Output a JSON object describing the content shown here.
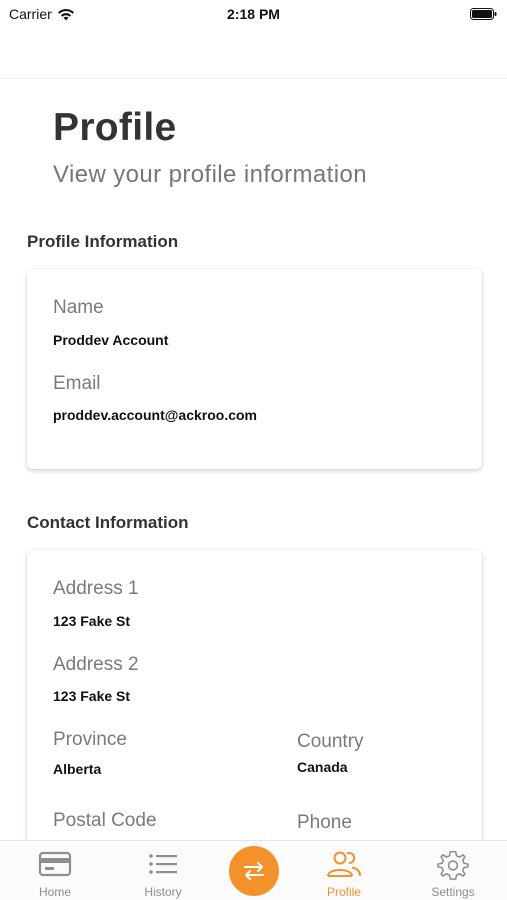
{
  "status_bar": {
    "carrier": "Carrier",
    "time": "2:18 PM"
  },
  "header": {
    "title": "Profile",
    "subtitle": "View your profile information"
  },
  "profile_section": {
    "title": "Profile Information",
    "name_label": "Name",
    "name_value": "Proddev Account",
    "email_label": "Email",
    "email_value": "proddev.account@ackroo.com"
  },
  "contact_section": {
    "title": "Contact Information",
    "address1_label": "Address 1",
    "address1_value": "123 Fake St",
    "address2_label": "Address 2",
    "address2_value": "123 Fake St",
    "province_label": "Province",
    "province_value": "Alberta",
    "country_label": "Country",
    "country_value": "Canada",
    "postal_label": "Postal Code",
    "phone_label": "Phone"
  },
  "tab_bar": {
    "home": "Home",
    "history": "History",
    "profile": "Profile",
    "settings": "Settings",
    "active": "profile",
    "accent_color": "#f3922a"
  }
}
